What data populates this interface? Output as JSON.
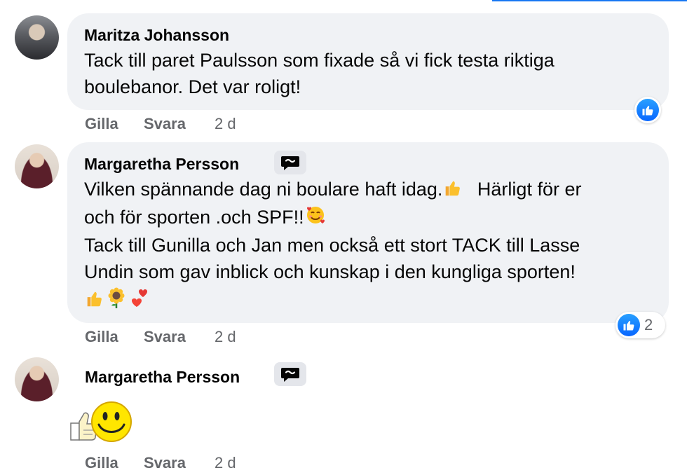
{
  "comments": [
    {
      "author": "Maritza Johansson",
      "lines": [
        "Tack till paret Paulsson som fixade så vi fick testa riktiga",
        "boulebanor. Det var roligt!"
      ],
      "actions": {
        "like": "Gilla",
        "reply": "Svara",
        "time": "2 d"
      },
      "reactions": {
        "type": "like",
        "count": ""
      }
    },
    {
      "author": "Margaretha Persson",
      "badge_icon": "top-fan-badge-icon",
      "lines": [
        "Vilken spännande dag ni boulare haft idag.",
        "Härligt för er",
        "och för sporten .och SPF!!",
        "Tack till Gunilla och Jan men också ett stort TACK till Lasse",
        "Undin som gav inblick och kunskap i den kungliga sporten!"
      ],
      "emojis": [
        "thumbs-up",
        "sunflower",
        "heart-exclamation",
        "smiling-face-with-hearts"
      ],
      "actions": {
        "like": "Gilla",
        "reply": "Svara",
        "time": "2 d"
      },
      "reactions": {
        "type": "like",
        "count": "2"
      }
    },
    {
      "author": "Margaretha Persson",
      "badge_icon": "top-fan-badge-icon",
      "sticker": "thumbs-up-smiley-sticker",
      "actions": {
        "like": "Gilla",
        "reply": "Svara",
        "time": "2 d"
      }
    }
  ],
  "colors": {
    "bubble": "#f0f2f5",
    "meta": "#65676b",
    "like_blue": "#1877f2"
  }
}
